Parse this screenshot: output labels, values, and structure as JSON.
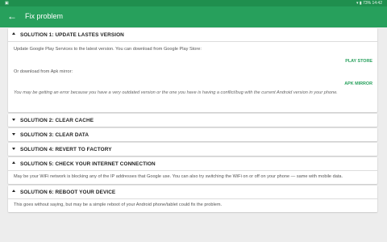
{
  "status": {
    "left_icon": "image-icon",
    "battery": "73%",
    "time": "14:42"
  },
  "toolbar": {
    "title": "Fix problem"
  },
  "solutions": [
    {
      "title": "SOLUTION 1: UPDATE LASTES VERSION"
    },
    {
      "title": "SOLUTION 2: CLEAR CACHE"
    },
    {
      "title": "SOLUTION 3: CLEAR DATA"
    },
    {
      "title": "SOLUTION 4: REVERT TO FACTORY"
    },
    {
      "title": "SOLUTION 5: CHECK YOUR INTERNET CONNECTION"
    },
    {
      "title": "SOLUTION 6: REBOOT YOUR DEVICE"
    }
  ],
  "s1": {
    "text1": "Update Google Play Services to the latest version. You can download from Google Play Store:",
    "button1": "PLAY STORE",
    "text2": "Or download from Apk mirror:",
    "button2": "APK MIRROR",
    "note": "You may be getting an error because you have a very outdated version or the one you have is having a conflict/bug with the current Android version in your phone."
  },
  "s5": {
    "text": "May be your WiFi network is blocking any of the IP addresses that Google use. You can also try switching the WiFi on or off on your phone — same with mobile data."
  },
  "s6": {
    "text": "This goes without saying, but may be a simple reboot of your Android phone/tablet could fix the problem."
  }
}
